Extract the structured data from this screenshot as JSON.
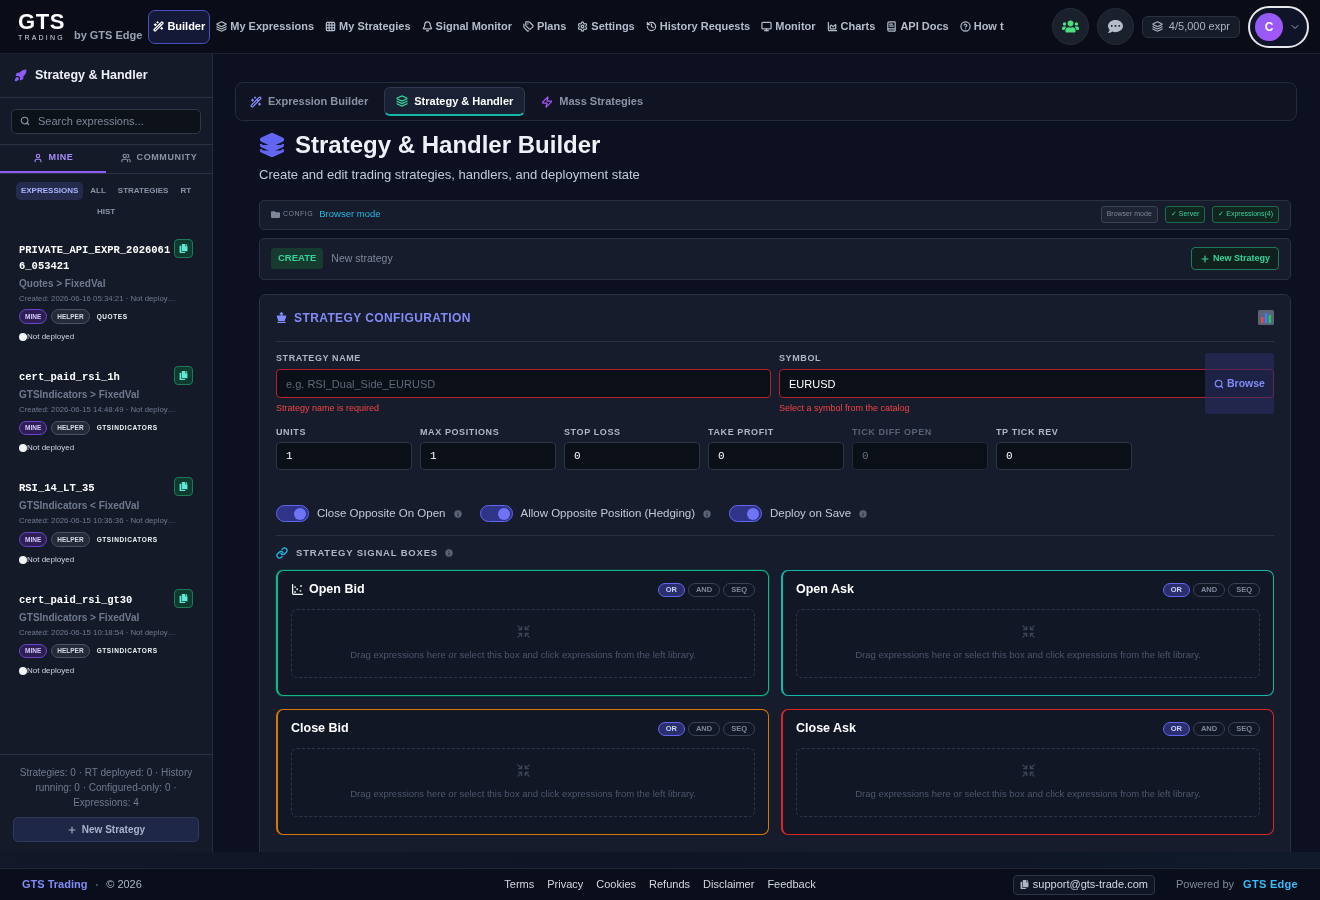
{
  "header": {
    "brand": {
      "logo": "GTS",
      "tagline": "TRADING",
      "byline": "by GTS Edge"
    },
    "nav": [
      {
        "label": "Builder",
        "selected": true
      },
      {
        "label": "My Expressions",
        "selected": false
      },
      {
        "label": "My Strategies",
        "selected": false
      },
      {
        "label": "Signal Monitor",
        "selected": false
      },
      {
        "label": "Plans",
        "selected": false
      },
      {
        "label": "Settings",
        "selected": false
      },
      {
        "label": "History Requests",
        "selected": false
      },
      {
        "label": "Monitor",
        "selected": false
      },
      {
        "label": "Charts",
        "selected": false
      },
      {
        "label": "API Docs",
        "selected": false
      },
      {
        "label": "How t",
        "selected": false
      }
    ],
    "quota": "4/5,000 expr",
    "avatar": "C"
  },
  "sidebar": {
    "title": "Strategy & Handler",
    "search": {
      "placeholder": "Search expressions..."
    },
    "tabs": [
      {
        "label": "MINE",
        "selected": true
      },
      {
        "label": "COMMUNITY",
        "selected": false
      }
    ],
    "filters": [
      {
        "label": "EXPRESSIONS",
        "selected": true
      },
      {
        "label": "ALL",
        "selected": false
      },
      {
        "label": "STRATEGIES",
        "selected": false
      },
      {
        "label": "RT",
        "selected": false
      },
      {
        "label": "HIST",
        "selected": false
      }
    ],
    "expressions": [
      {
        "name": "PRIVATE_API_EXPR_20260616_053421",
        "path": "Quotes > FixedVal",
        "created": "Created: 2026-06-16 05:34:21 · Not deploy…",
        "tags": [
          {
            "label": "MINE",
            "kind": "mine"
          },
          {
            "label": "HELPER",
            "kind": "helper"
          },
          {
            "label": "QUOTES",
            "kind": "category"
          }
        ],
        "status": "Not deployed"
      },
      {
        "name": "cert_paid_rsi_1h",
        "path": "GTSIndicators > FixedVal",
        "created": "Created: 2026-06-15 14:48:49 · Not deploy…",
        "tags": [
          {
            "label": "MINE",
            "kind": "mine"
          },
          {
            "label": "HELPER",
            "kind": "helper"
          },
          {
            "label": "GTSINDICATORS",
            "kind": "category"
          }
        ],
        "status": "Not deployed"
      },
      {
        "name": "RSI_14_LT_35",
        "path": "GTSIndicators < FixedVal",
        "created": "Created: 2026-06-15 10:36:36 · Not deploy…",
        "tags": [
          {
            "label": "MINE",
            "kind": "mine"
          },
          {
            "label": "HELPER",
            "kind": "helper"
          },
          {
            "label": "GTSINDICATORS",
            "kind": "category"
          }
        ],
        "status": "Not deployed"
      },
      {
        "name": "cert_paid_rsi_gt30",
        "path": "GTSIndicators > FixedVal",
        "created": "Created: 2026-06-15 10:18:54 · Not deploy…",
        "tags": [
          {
            "label": "MINE",
            "kind": "mine"
          },
          {
            "label": "HELPER",
            "kind": "helper"
          },
          {
            "label": "GTSINDICATORS",
            "kind": "category"
          }
        ],
        "status": "Not deployed"
      }
    ],
    "stats": "Strategies: 0 · RT deployed: 0 · History running: 0 · Configured-only: 0 · Expressions: 4",
    "new_button": "New Strategy"
  },
  "builder_tabs": [
    {
      "label": "Expression Builder",
      "selected": false
    },
    {
      "label": "Strategy & Handler",
      "selected": true
    },
    {
      "label": "Mass Strategies",
      "selected": false
    }
  ],
  "page": {
    "title": "Strategy & Handler Builder",
    "subtitle": "Create and edit trading strategies, handlers, and deployment state"
  },
  "config_bar": {
    "label": "CONFIG",
    "mode": "Browser mode",
    "badges": [
      {
        "label": "Browser mode",
        "kind": "neutral"
      },
      {
        "label": "✓ Server",
        "kind": "ok"
      },
      {
        "label": "✓ Expressions(4)",
        "kind": "ok"
      }
    ]
  },
  "create_bar": {
    "badge": "CREATE",
    "text": "New strategy",
    "button": "New Strategy"
  },
  "strategy_config": {
    "title": "STRATEGY CONFIGURATION",
    "strategy_name": {
      "label": "STRATEGY NAME",
      "placeholder": "e.g. RSI_Dual_Side_EURUSD",
      "error": "Strategy name is required"
    },
    "symbol": {
      "label": "SYMBOL",
      "value": "EURUSD",
      "browse": "Browse",
      "error": "Select a symbol from the catalog"
    },
    "numbers": [
      {
        "label": "UNITS",
        "value": "1",
        "disabled": false
      },
      {
        "label": "MAX POSITIONS",
        "value": "1",
        "disabled": false
      },
      {
        "label": "STOP LOSS",
        "value": "0",
        "disabled": false
      },
      {
        "label": "TAKE PROFIT",
        "value": "0",
        "disabled": false
      },
      {
        "label": "TICK DIFF OPEN",
        "value": "0",
        "disabled": true
      },
      {
        "label": "TP TICK REV",
        "value": "0",
        "disabled": false
      }
    ],
    "toggles": [
      {
        "label": "Close Opposite On Open",
        "on": true
      },
      {
        "label": "Allow Opposite Position (Hedging)",
        "on": true
      },
      {
        "label": "Deploy on Save",
        "on": true
      }
    ],
    "signal_title": "STRATEGY SIGNAL BOXES",
    "signal_boxes": [
      {
        "title": "Open Bid",
        "color": "#10b981",
        "selected": true,
        "modes": [
          {
            "label": "OR",
            "selected": true
          },
          {
            "label": "AND",
            "selected": false
          },
          {
            "label": "SEQ",
            "selected": false
          }
        ],
        "hint": "Drag expressions here or select this box and click expressions from the left library."
      },
      {
        "title": "Open Ask",
        "color": "#14b8a6",
        "selected": false,
        "modes": [
          {
            "label": "OR",
            "selected": true
          },
          {
            "label": "AND",
            "selected": false
          },
          {
            "label": "SEQ",
            "selected": false
          }
        ],
        "hint": "Drag expressions here or select this box and click expressions from the left library."
      },
      {
        "title": "Close Bid",
        "color": "#d97706",
        "selected": false,
        "modes": [
          {
            "label": "OR",
            "selected": true
          },
          {
            "label": "AND",
            "selected": false
          },
          {
            "label": "SEQ",
            "selected": false
          }
        ],
        "hint": "Drag expressions here or select this box and click expressions from the left library."
      },
      {
        "title": "Close Ask",
        "color": "#dc2626",
        "selected": false,
        "modes": [
          {
            "label": "OR",
            "selected": true
          },
          {
            "label": "AND",
            "selected": false
          },
          {
            "label": "SEQ",
            "selected": false
          }
        ],
        "hint": "Drag expressions here or select this box and click expressions from the left library."
      }
    ]
  },
  "footer": {
    "brand": "GTS Trading",
    "separator": "•",
    "copyright": "© 2026",
    "links": [
      "Terms",
      "Privacy",
      "Cookies",
      "Refunds",
      "Disclaimer",
      "Feedback"
    ],
    "support": "support@gts-trade.com",
    "powered_label": "Powered by",
    "powered_brand": "GTS Edge"
  }
}
